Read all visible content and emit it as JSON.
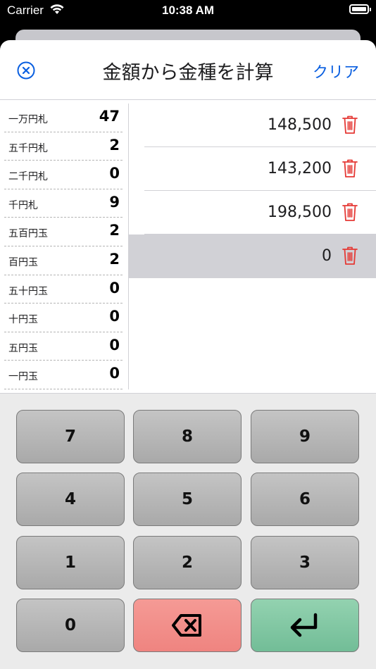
{
  "status": {
    "carrier": "Carrier",
    "time": "10:38 AM"
  },
  "nav": {
    "title": "金額から金種を計算",
    "clear": "クリア"
  },
  "denominations": [
    {
      "label": "一万円札",
      "count": "47"
    },
    {
      "label": "五千円札",
      "count": "2"
    },
    {
      "label": "二千円札",
      "count": "0"
    },
    {
      "label": "千円札",
      "count": "9"
    },
    {
      "label": "五百円玉",
      "count": "2"
    },
    {
      "label": "百円玉",
      "count": "2"
    },
    {
      "label": "五十円玉",
      "count": "0"
    },
    {
      "label": "十円玉",
      "count": "0"
    },
    {
      "label": "五円玉",
      "count": "0"
    },
    {
      "label": "一円玉",
      "count": "0"
    }
  ],
  "amounts": [
    {
      "value": "148,500",
      "selected": false
    },
    {
      "value": "143,200",
      "selected": false
    },
    {
      "value": "198,500",
      "selected": false
    },
    {
      "value": "0",
      "selected": true
    }
  ],
  "keypad": {
    "k7": "7",
    "k8": "8",
    "k9": "9",
    "k4": "4",
    "k5": "5",
    "k6": "6",
    "k1": "1",
    "k2": "2",
    "k3": "3",
    "k0": "0"
  },
  "icons": {
    "close": "close-circle-icon",
    "trash": "trash-icon",
    "delete": "backspace-icon",
    "enter": "return-icon"
  },
  "colors": {
    "accent": "#0a5fe0",
    "trash": "#e53935",
    "delete_key": "#f08e89",
    "enter_key": "#7fc6a1",
    "selected_row": "#d1d1d6"
  }
}
